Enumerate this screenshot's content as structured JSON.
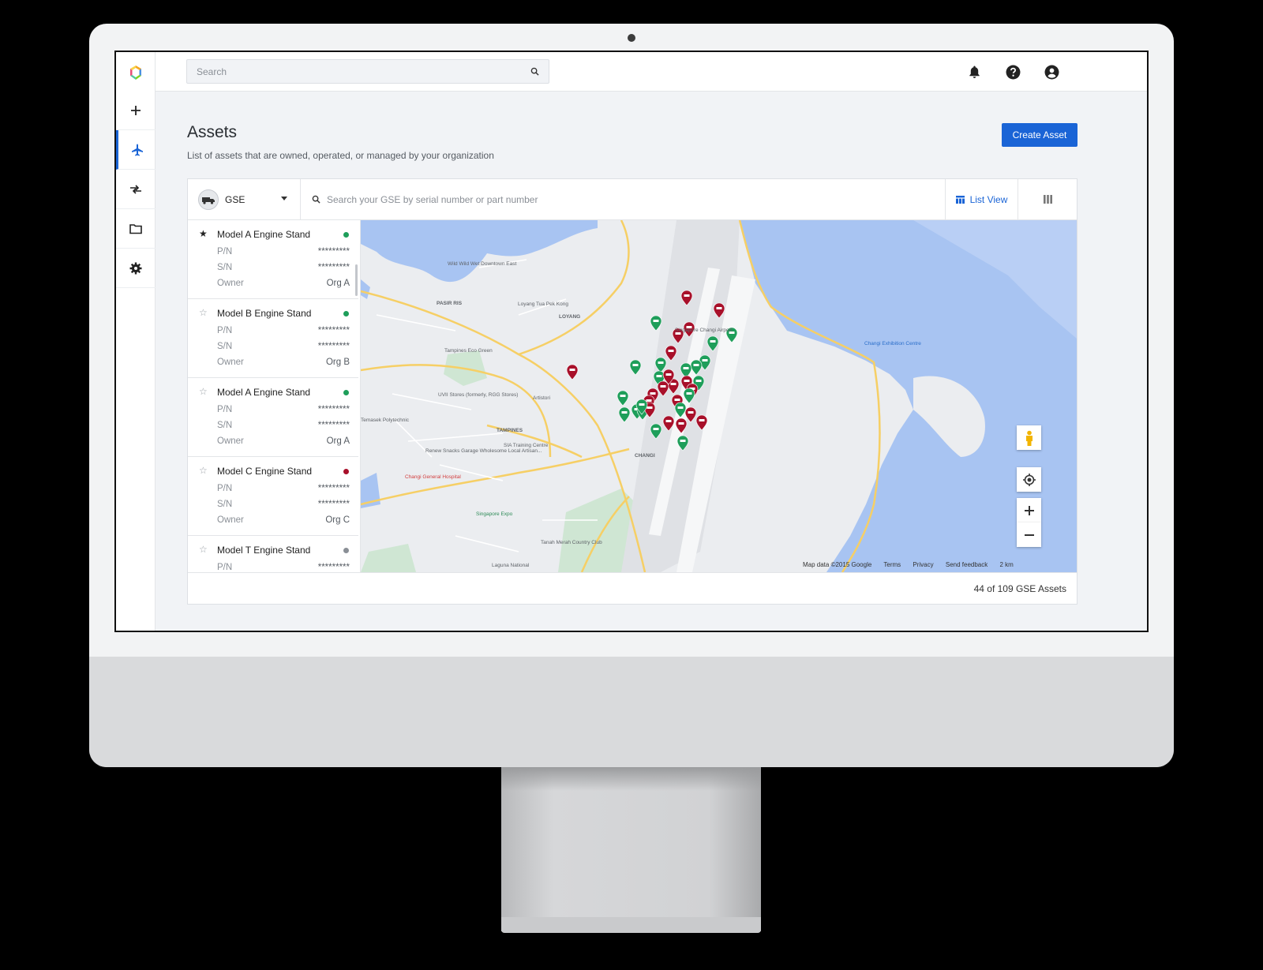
{
  "topbar": {
    "search_placeholder": "Search"
  },
  "page": {
    "title": "Assets",
    "subtitle": "List of assets that are owned, operated, or managed by your organization",
    "create_button": "Create Asset"
  },
  "toolbar": {
    "type_label": "GSE",
    "search_placeholder": "Search your GSE by serial number or part number",
    "list_view_label": "List View"
  },
  "assets": [
    {
      "name": "Model A Engine Stand",
      "starred": true,
      "status_color": "#1e9e5a",
      "pn_label": "P/N",
      "pn": "*********",
      "sn_label": "S/N",
      "sn": "*********",
      "owner_label": "Owner",
      "owner": "Org A"
    },
    {
      "name": "Model B Engine Stand",
      "starred": false,
      "status_color": "#1e9e5a",
      "pn_label": "P/N",
      "pn": "*********",
      "sn_label": "S/N",
      "sn": "*********",
      "owner_label": "Owner",
      "owner": "Org B"
    },
    {
      "name": "Model A Engine Stand",
      "starred": false,
      "status_color": "#1e9e5a",
      "pn_label": "P/N",
      "pn": "*********",
      "sn_label": "S/N",
      "sn": "*********",
      "owner_label": "Owner",
      "owner": "Org A"
    },
    {
      "name": "Model C Engine Stand",
      "starred": false,
      "status_color": "#a8102a",
      "pn_label": "P/N",
      "pn": "*********",
      "sn_label": "S/N",
      "sn": "*********",
      "owner_label": "Owner",
      "owner": "Org C"
    },
    {
      "name": "Model T Engine Stand",
      "starred": false,
      "status_color": "#8a8f96",
      "pn_label": "P/N",
      "pn": "*********"
    }
  ],
  "map": {
    "labels": [
      "PASIR RIS",
      "LOYANG",
      "TAMPINES",
      "CHANGI",
      "Loyang Tua Pek Kong",
      "Tampines Eco Green",
      "UVII Stores (formerly, RGG Stores)",
      "Artistori",
      "Renew Snacks Garage Wholesome Local Artisan...",
      "SIA Training Centre",
      "Changi General Hospital",
      "Singapore Expo",
      "Tanah Merah Country Club",
      "Laguna National",
      "Changi Exhibition Centre",
      "Wild Wild Wet Downtown East",
      "Singapore Changi Airport",
      "Temasek Polytechnic"
    ],
    "footer": [
      "Map data ©2015 Google",
      "Terms",
      "Privacy",
      "Send feedback",
      "2 km"
    ],
    "marker_colors": {
      "green": "#1e9e5a",
      "red": "#a8102a"
    }
  },
  "footer": {
    "count_text": "44 of 109 GSE Assets"
  },
  "colors": {
    "accent": "#1a64d6",
    "water": "#a8c4f2"
  }
}
